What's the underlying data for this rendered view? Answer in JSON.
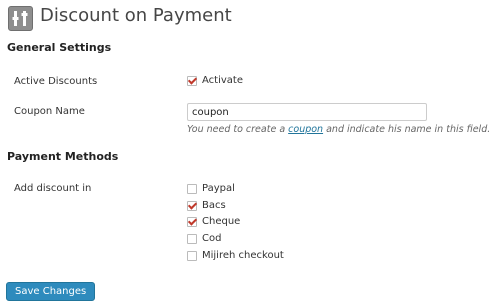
{
  "header": {
    "title": "Discount on Payment",
    "icon": "settings-tools-icon"
  },
  "general": {
    "title": "General Settings",
    "active_discounts": {
      "label": "Active Discounts",
      "checkbox_label": "Activate",
      "checked": true
    },
    "coupon": {
      "label": "Coupon Name",
      "value": "coupon",
      "help_before": "You need to create a ",
      "help_link": "coupon",
      "help_after": " and indicate his name in this field."
    }
  },
  "payment": {
    "title": "Payment Methods",
    "label": "Add discount in",
    "options": [
      {
        "label": "Paypal",
        "checked": false
      },
      {
        "label": "Bacs",
        "checked": true
      },
      {
        "label": "Cheque",
        "checked": true
      },
      {
        "label": "Cod",
        "checked": false
      },
      {
        "label": "Mijireh checkout",
        "checked": false
      }
    ]
  },
  "actions": {
    "save_label": "Save Changes"
  },
  "colors": {
    "accent": "#21759b",
    "check": "#c0392b"
  }
}
